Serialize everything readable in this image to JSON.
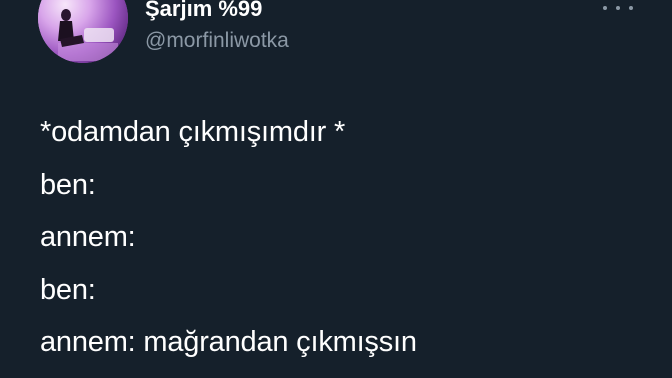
{
  "tweet": {
    "author": {
      "display_name": "Şarjım %99",
      "handle": "@morfinliwotka",
      "avatar_icon": "profile-photo"
    },
    "more_icon": "more-horizontal-icon",
    "lines": [
      "*odamdan çıkmışımdır *",
      "ben:",
      "annem:",
      "ben:",
      "annem: mağrandan çıkmışsın"
    ]
  },
  "colors": {
    "background": "#15202b",
    "text": "#ffffff",
    "secondary_text": "#8b98a5"
  }
}
